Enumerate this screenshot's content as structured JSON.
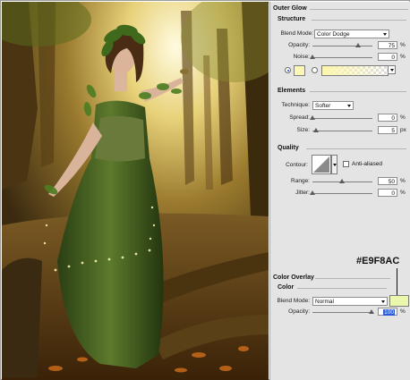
{
  "outer_glow": {
    "title": "Outer Glow",
    "structure": {
      "title": "Structure",
      "blend_mode_label": "Blend Mode:",
      "blend_mode_value": "Color Dodge",
      "opacity_label": "Opacity:",
      "opacity_value": "75",
      "noise_label": "Noise:",
      "noise_value": "0",
      "percent": "%",
      "glow_color": "#fbf7b6",
      "gradient_color": "#fdf6ad"
    },
    "elements": {
      "title": "Elements",
      "technique_label": "Technique:",
      "technique_value": "Softer",
      "spread_label": "Spread:",
      "spread_value": "0",
      "size_label": "Size:",
      "size_value": "5",
      "percent": "%",
      "px": "px"
    },
    "quality": {
      "title": "Quality",
      "contour_label": "Contour:",
      "anti_aliased_label": "Anti-aliased",
      "range_label": "Range:",
      "range_value": "50",
      "jitter_label": "Jitter:",
      "jitter_value": "0",
      "percent": "%"
    }
  },
  "color_overlay": {
    "annotation": "#E9F8AC",
    "title": "Color Overlay",
    "color_title": "Color",
    "blend_mode_label": "Blend Mode:",
    "blend_mode_value": "Normal",
    "opacity_label": "Opacity:",
    "opacity_value": "100",
    "percent": "%",
    "swatch_color": "#e9f8ac"
  }
}
